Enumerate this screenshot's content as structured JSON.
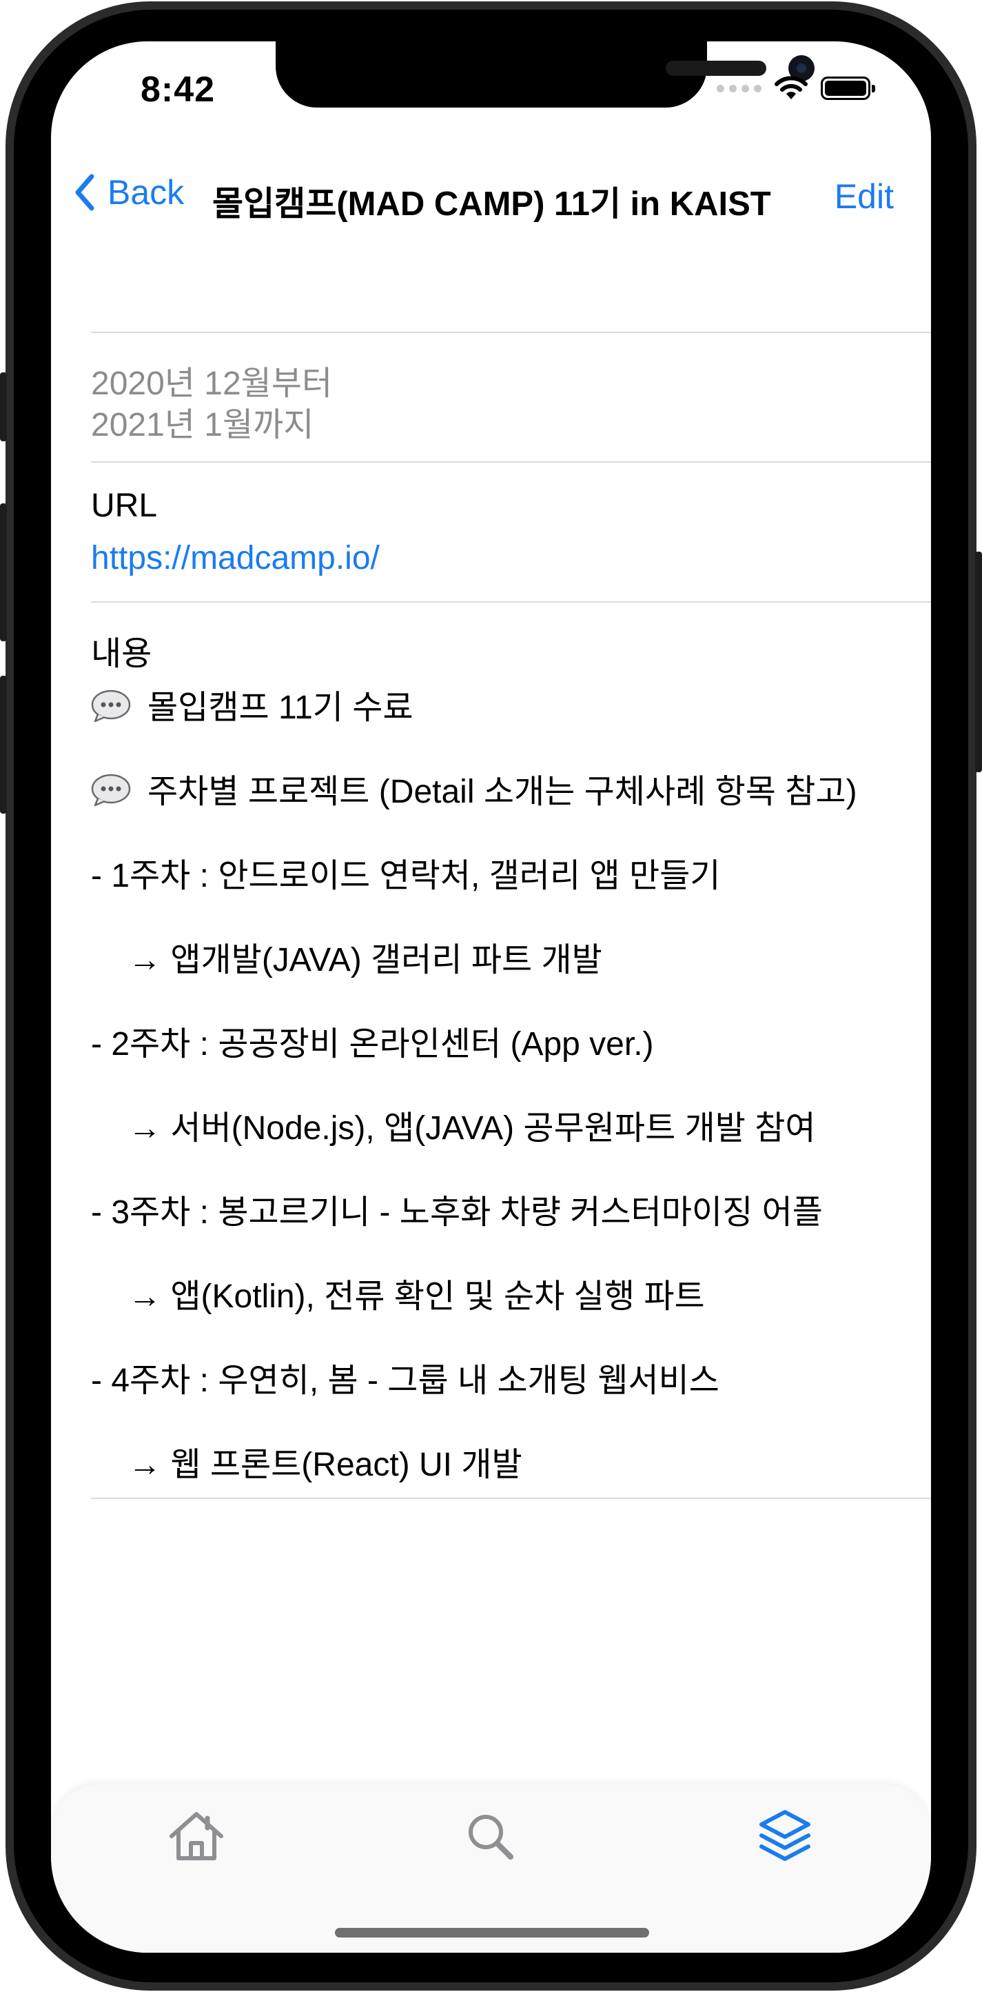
{
  "status_bar": {
    "time": "8:42"
  },
  "nav": {
    "back_label": "Back",
    "title": "몰입캠프(MAD CAMP) 11기 in KAIST",
    "edit_label": "Edit"
  },
  "period": {
    "start": "2020년 12월부터",
    "end": "2021년 1월까지"
  },
  "url_section": {
    "label": "URL",
    "value": "https://madcamp.io/"
  },
  "content_section": {
    "label": "내용",
    "lines": [
      "몰입캠프 11기 수료",
      "주차별 프로젝트 (Detail 소개는 구체사례 항목 참고)",
      "- 1주차 : 안드로이드 연락처, 갤러리 앱 만들기",
      "→ 앱개발(JAVA) 갤러리 파트 개발",
      "- 2주차 : 공공장비 온라인센터 (App ver.)",
      "→ 서버(Node.js), 앱(JAVA) 공무원파트 개발 참여",
      "- 3주차 : 봉고르기니 - 노후화 차량 커스터마이징 어플",
      "→ 앱(Kotlin), 전류 확인 및 순차 실행 파트",
      "- 4주차 : 우연히, 봄 - 그룹 내 소개팅 웹서비스",
      "→ 웹 프론트(React) UI 개발"
    ]
  },
  "tab_bar": {
    "tabs": [
      {
        "icon": "home-icon",
        "active": false
      },
      {
        "icon": "search-icon",
        "active": false
      },
      {
        "icon": "layers-icon",
        "active": true
      }
    ]
  },
  "colors": {
    "accent": "#1a7cf0",
    "secondary_text": "#8c8c8c",
    "divider": "#dcdce0",
    "inactive_icon": "#8e8e93"
  }
}
